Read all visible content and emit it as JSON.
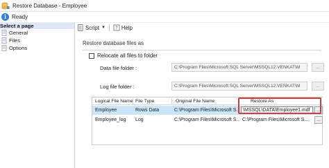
{
  "window": {
    "title": "Restore Database - Employee"
  },
  "status": {
    "text": "Ready"
  },
  "sidebar": {
    "header": "Select a page",
    "items": [
      {
        "label": "General",
        "icon": "page-icon"
      },
      {
        "label": "Files",
        "icon": "page-icon"
      },
      {
        "label": "Options",
        "icon": "page-icon"
      }
    ]
  },
  "toolbar": {
    "script_label": "Script",
    "help_label": "Help"
  },
  "main": {
    "section_title": "Restore database files as",
    "relocate_label": "Relocate all files to folder",
    "relocate_checked": false,
    "data_folder_label": "Data file folder :",
    "data_folder_value": "C:\\Program Files\\Microsoft SQL Server\\MSSQL12.VENKAT\\M",
    "log_folder_label": "Log file folder :",
    "log_folder_value": "C:\\Program Files\\Microsoft SQL Server\\MSSQL12.VENKAT\\M",
    "browse_label": "..."
  },
  "grid": {
    "columns": [
      "Logical File Name",
      "File Type",
      "Original File Name",
      "Restore As"
    ],
    "rows": [
      {
        "logical": "Employee",
        "type": "Rows Data",
        "original": "C:\\Program Files\\Microsoft S...",
        "restore_as": "\\MSSQL\\DATA\\Employee1.mdf",
        "button": "..."
      },
      {
        "logical": "Employee_log",
        "type": "Log",
        "original": "C:\\Program Files\\Microsoft S...",
        "restore_as": "C:\\Program Files\\Microsoft S...",
        "button": "..."
      }
    ]
  },
  "colors": {
    "selection": "#cce4f7",
    "highlight_border": "#d23b3b",
    "sidebar_header": "#dfe8f6",
    "info_icon": "#2f7fd6"
  }
}
